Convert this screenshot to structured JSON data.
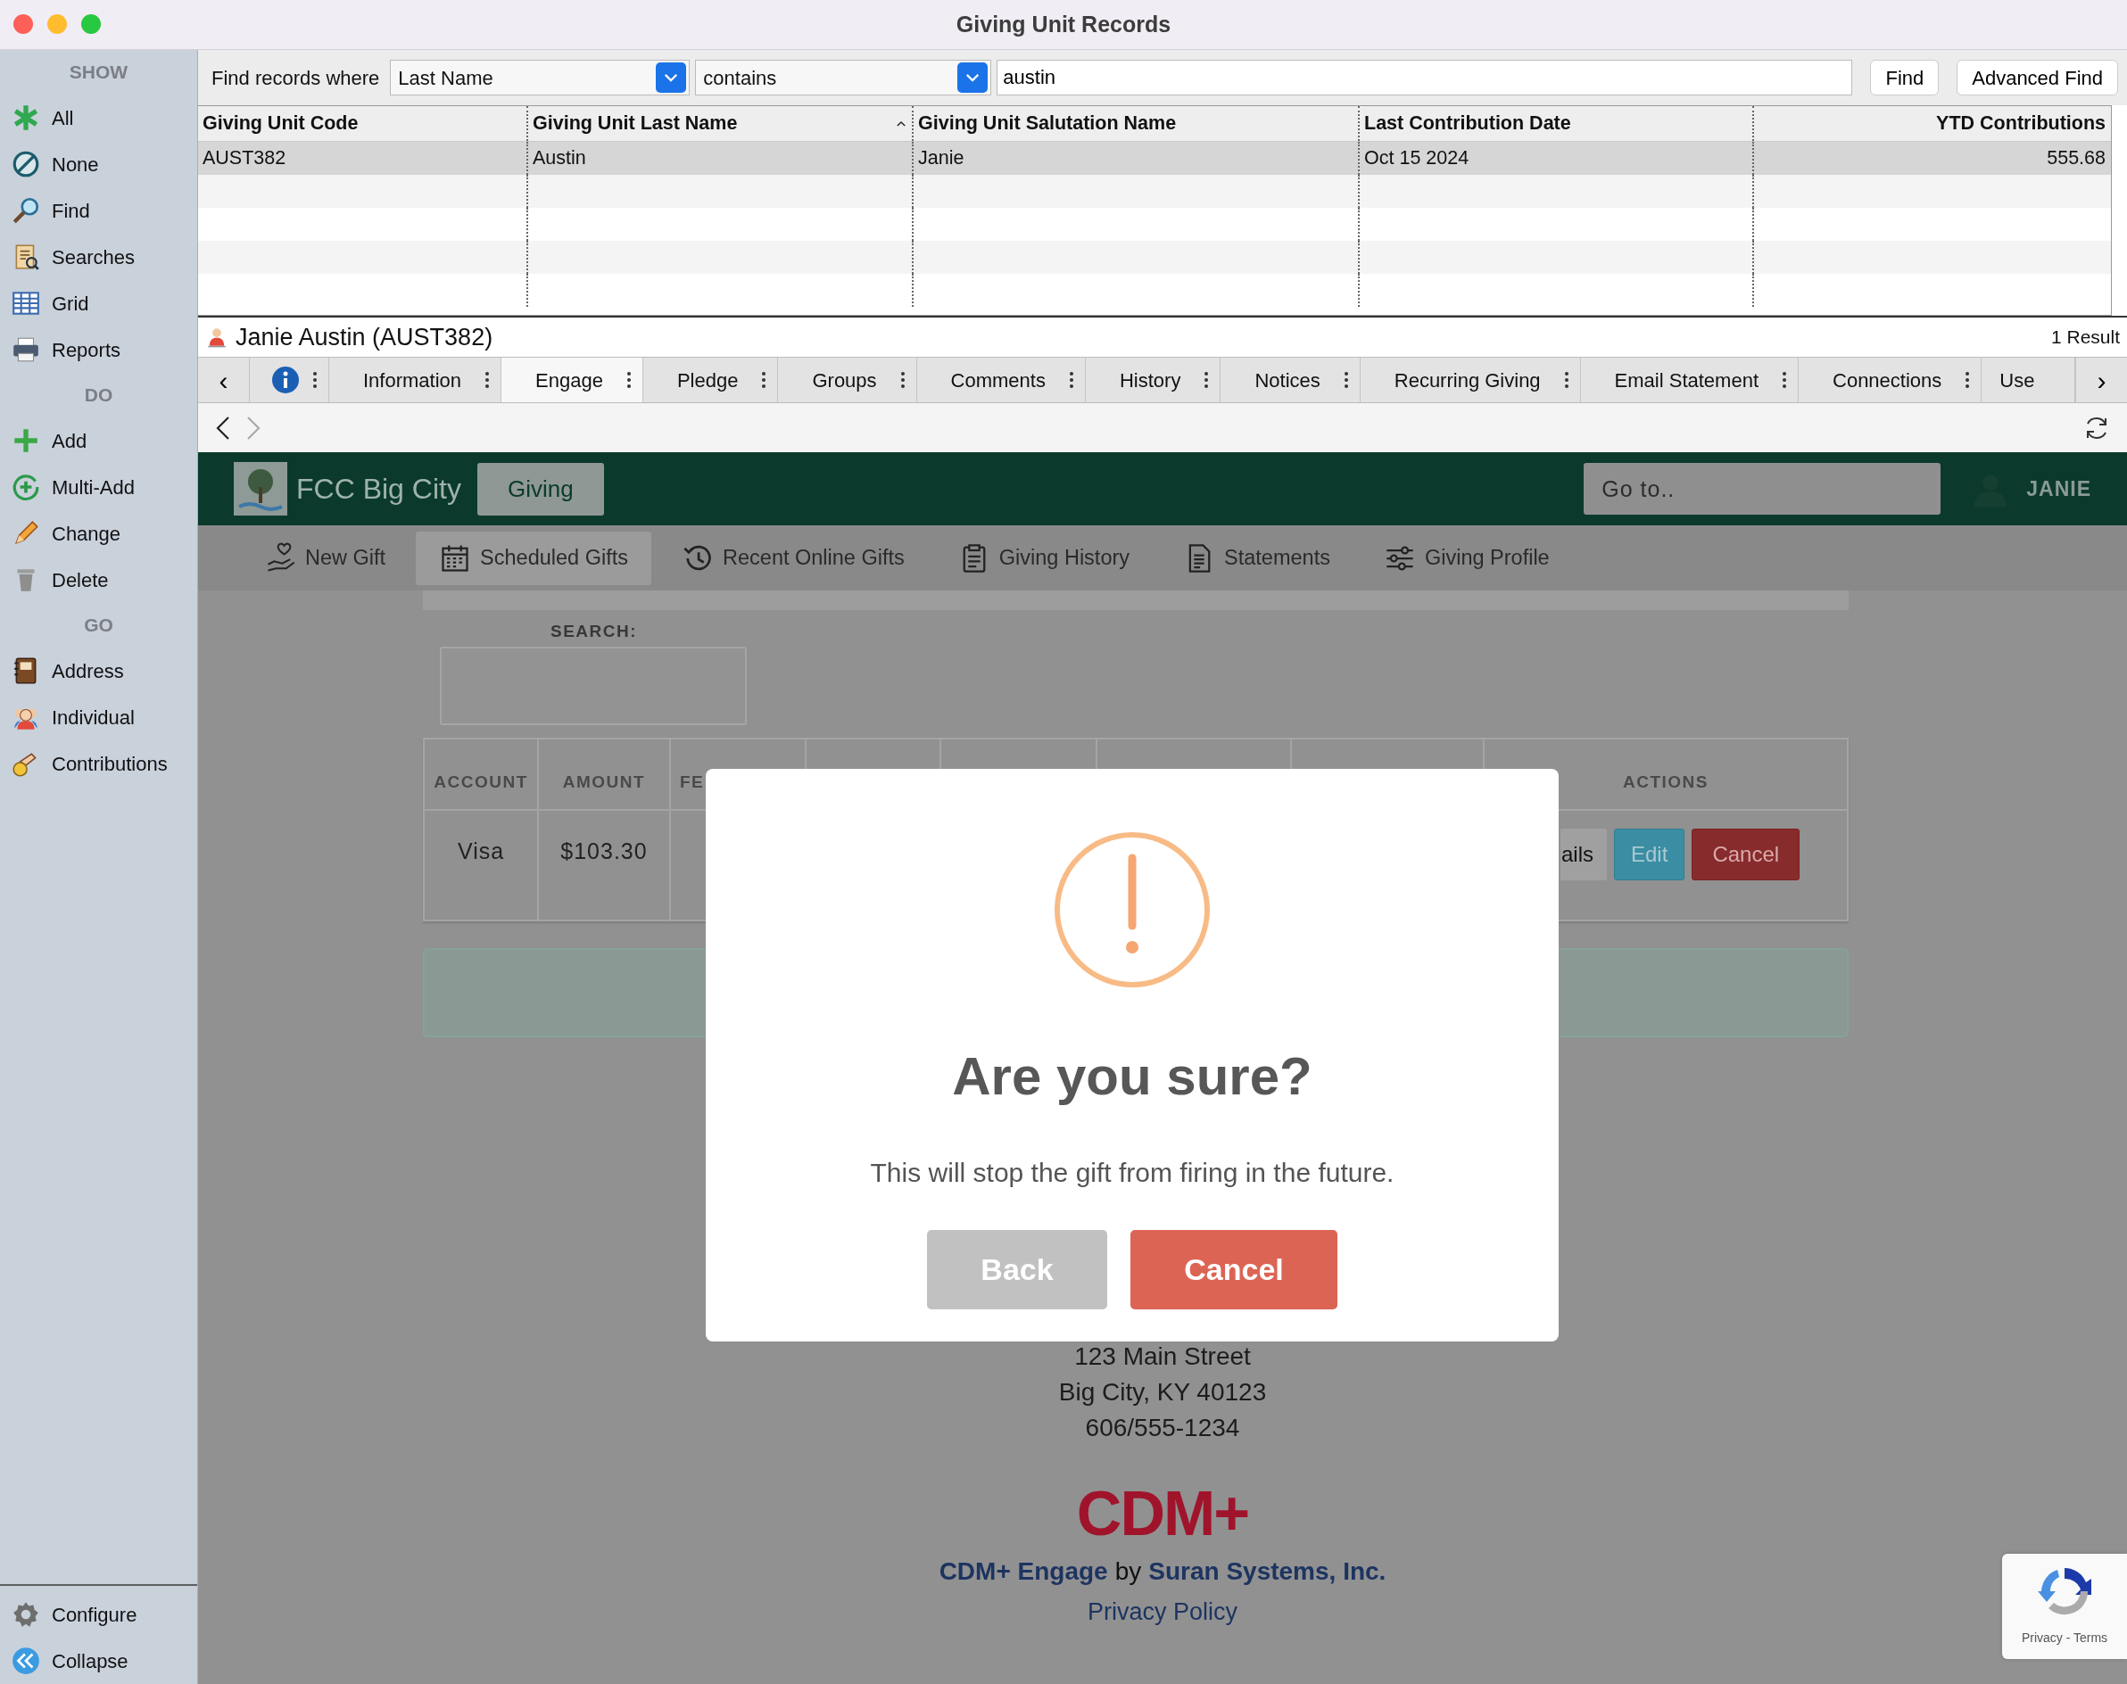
{
  "window": {
    "title": "Giving Unit Records"
  },
  "sidebar": {
    "sections": [
      {
        "heading": "SHOW",
        "items": [
          {
            "label": "All"
          },
          {
            "label": "None"
          },
          {
            "label": "Find"
          },
          {
            "label": "Searches"
          },
          {
            "label": "Grid"
          },
          {
            "label": "Reports"
          }
        ]
      },
      {
        "heading": "DO",
        "items": [
          {
            "label": "Add"
          },
          {
            "label": "Multi-Add"
          },
          {
            "label": "Change"
          },
          {
            "label": "Delete"
          }
        ]
      },
      {
        "heading": "GO",
        "items": [
          {
            "label": "Address"
          },
          {
            "label": "Individual"
          },
          {
            "label": "Contributions"
          }
        ]
      }
    ],
    "footer_items": [
      {
        "label": "Configure"
      },
      {
        "label": "Collapse"
      }
    ]
  },
  "find_bar": {
    "label": "Find records where",
    "field": "Last Name",
    "operator": "contains",
    "value": "austin",
    "buttons": [
      "Find",
      "Advanced Find"
    ]
  },
  "table": {
    "columns": [
      {
        "label": "Giving Unit Code",
        "sorted": false
      },
      {
        "label": "Giving Unit Last Name",
        "sorted": true
      },
      {
        "label": "Giving Unit Salutation Name",
        "sorted": false
      },
      {
        "label": "Last Contribution Date",
        "sorted": false
      },
      {
        "label": "YTD Contributions",
        "sorted": false
      }
    ],
    "rows": [
      {
        "cells": [
          "AUST382",
          "Austin",
          "Janie",
          "Oct 15 2024",
          "555.68"
        ],
        "selected": true
      }
    ]
  },
  "record": {
    "name": "Janie Austin (AUST382)",
    "result_count": "1 Result"
  },
  "tab_scroll": {
    "left": "‹",
    "right": "›"
  },
  "tabs": [
    {
      "label": "Information",
      "selected": false
    },
    {
      "label": "Engage",
      "selected": true
    },
    {
      "label": "Pledge",
      "selected": false
    },
    {
      "label": "Groups",
      "selected": false
    },
    {
      "label": "Comments",
      "selected": false
    },
    {
      "label": "History",
      "selected": false
    },
    {
      "label": "Notices",
      "selected": false
    },
    {
      "label": "Recurring Giving",
      "selected": false
    },
    {
      "label": "Email Statement",
      "selected": false
    },
    {
      "label": "Connections",
      "selected": false
    },
    {
      "label": "Use",
      "selected": false
    }
  ],
  "nav": {
    "back": {
      "disabled": false
    },
    "forward": {
      "disabled": true
    }
  },
  "web_header": {
    "org": "FCC Big City",
    "app_button": "Giving",
    "goto_placeholder": "Go to..",
    "user": "JANIE"
  },
  "web_nav": [
    {
      "label": "New Gift",
      "selected": false
    },
    {
      "label": "Scheduled Gifts",
      "selected": true
    },
    {
      "label": "Recent Online Gifts",
      "selected": false
    },
    {
      "label": "Giving History",
      "selected": false
    },
    {
      "label": "Statements",
      "selected": false
    },
    {
      "label": "Giving Profile",
      "selected": false
    }
  ],
  "gifts": {
    "search_label": "SEARCH:",
    "columns": [
      "ACCOUNT",
      "AMOUNT",
      "FE"
    ],
    "actions_header": "ACTIONS",
    "row": {
      "account": "Visa",
      "amount": "$103.30",
      "buttons": [
        {
          "label": "ails",
          "kind": "details"
        },
        {
          "label": "Edit",
          "kind": "edit"
        },
        {
          "label": "Cancel",
          "kind": "cancel"
        }
      ]
    }
  },
  "footer": {
    "address_lines": [
      "123 Main Street",
      "Big City, KY 40123",
      "606/555-1234"
    ],
    "logo": "CDM+",
    "credit": [
      {
        "text": "CDM+ Engage",
        "kind": "link"
      },
      {
        "text": "by",
        "kind": "text"
      },
      {
        "text": "Suran Systems, Inc.",
        "kind": "link"
      }
    ],
    "privacy": "Privacy Policy"
  },
  "recaptcha": {
    "links": "Privacy - Terms"
  },
  "dialog": {
    "title": "Are you sure?",
    "message": "This will stop the gift from firing in the future.",
    "buttons": [
      {
        "label": "Back",
        "kind": "back"
      },
      {
        "label": "Cancel",
        "kind": "confirm"
      }
    ]
  }
}
